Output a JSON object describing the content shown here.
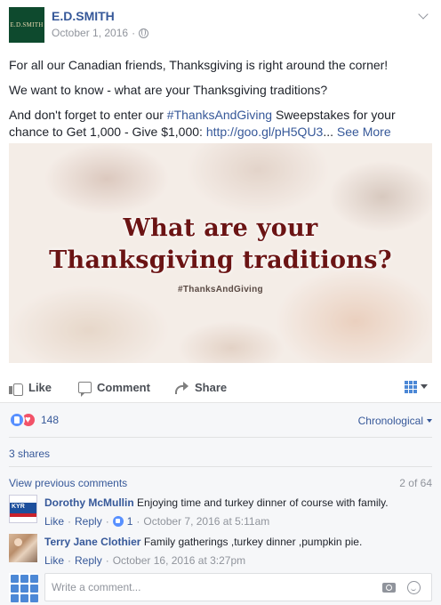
{
  "post": {
    "page_name": "E.D.SMITH",
    "logo_text": "E.D.SMITH",
    "date": "October 1, 2016",
    "separator": "·",
    "paragraphs": {
      "p1": "For all our Canadian friends, Thanksgiving is right around the corner!",
      "p2": "We want to know - what are your Thanksgiving traditions?",
      "p3_before": "And don't forget to enter our ",
      "p3_hashtag": "#ThanksAndGiving",
      "p3_middle": " Sweepstakes for your chance to Get 1,000 - Give $1,000: ",
      "p3_url": "http://goo.gl/pH5QU3",
      "p3_ellipsis": "... ",
      "see_more": "See More"
    },
    "image": {
      "line1": "What are your",
      "line2": "Thanksgiving traditions?",
      "hashtag": "#ThanksAndGiving"
    }
  },
  "actions": {
    "like": "Like",
    "comment": "Comment",
    "share": "Share"
  },
  "summary": {
    "reaction_count": "148",
    "sort_label": "Chronological",
    "shares": "3 shares",
    "view_previous": "View previous comments",
    "comment_count": "2 of 64"
  },
  "comments": [
    {
      "name": "Dorothy McMullin",
      "text": "Enjoying time and turkey dinner of course with family.",
      "like": "Like",
      "reply": "Reply",
      "likes": "1",
      "time": "October 7, 2016 at 5:11am",
      "avatar_text": "KYR"
    },
    {
      "name": "Terry Jane Clothier",
      "text": "Family gatherings ,turkey dinner ,pumpkin pie.",
      "like": "Like",
      "reply": "Reply",
      "time": "October 16, 2016 at 3:27pm"
    }
  ],
  "composer": {
    "placeholder": "Write a comment..."
  },
  "colors": {
    "link": "#365899",
    "brand_green": "#0e4a2e",
    "title_red": "#6b1414"
  }
}
